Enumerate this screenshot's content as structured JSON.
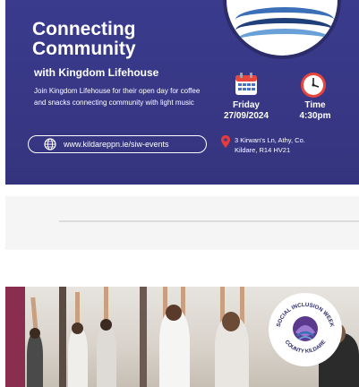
{
  "banner": {
    "title_line1": "Connecting",
    "title_line2": "Community",
    "subtitle": "with Kingdom Lifehouse",
    "description": "Join Kingdom Lifehouse for their open day for coffee and snacks connecting community with light music",
    "url": "www.kildareppn.ie/siw-events",
    "date_label": "Friday",
    "date_value": "27/09/2024",
    "time_label": "Time",
    "time_value": "4:30pm",
    "address_line1": "3 Kirwan's Ln, Athy, Co.",
    "address_line2": "Kildare, R14 HV21",
    "icons": [
      "globe-icon",
      "calendar-icon",
      "clock-icon",
      "location-pin-icon"
    ]
  },
  "photo": {
    "badge_text_top": "SOCIAL INCLUSION WEEK",
    "badge_text_bottom": "COUNTY KILDARE"
  },
  "colors": {
    "banner_bg": "#3b3b8e",
    "pin_red": "#e63b3b",
    "logo_blue": "#3b6fb8"
  }
}
